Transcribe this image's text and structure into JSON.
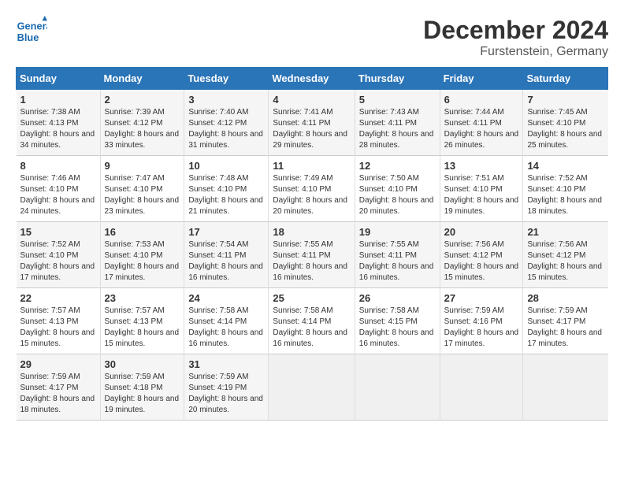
{
  "header": {
    "logo_line1": "General",
    "logo_line2": "Blue",
    "month": "December 2024",
    "location": "Furstenstein, Germany"
  },
  "weekdays": [
    "Sunday",
    "Monday",
    "Tuesday",
    "Wednesday",
    "Thursday",
    "Friday",
    "Saturday"
  ],
  "weeks": [
    [
      {
        "day": "1",
        "sunrise": "7:38 AM",
        "sunset": "4:13 PM",
        "daylight": "8 hours and 34 minutes."
      },
      {
        "day": "2",
        "sunrise": "7:39 AM",
        "sunset": "4:12 PM",
        "daylight": "8 hours and 33 minutes."
      },
      {
        "day": "3",
        "sunrise": "7:40 AM",
        "sunset": "4:12 PM",
        "daylight": "8 hours and 31 minutes."
      },
      {
        "day": "4",
        "sunrise": "7:41 AM",
        "sunset": "4:11 PM",
        "daylight": "8 hours and 29 minutes."
      },
      {
        "day": "5",
        "sunrise": "7:43 AM",
        "sunset": "4:11 PM",
        "daylight": "8 hours and 28 minutes."
      },
      {
        "day": "6",
        "sunrise": "7:44 AM",
        "sunset": "4:11 PM",
        "daylight": "8 hours and 26 minutes."
      },
      {
        "day": "7",
        "sunrise": "7:45 AM",
        "sunset": "4:10 PM",
        "daylight": "8 hours and 25 minutes."
      }
    ],
    [
      {
        "day": "8",
        "sunrise": "7:46 AM",
        "sunset": "4:10 PM",
        "daylight": "8 hours and 24 minutes."
      },
      {
        "day": "9",
        "sunrise": "7:47 AM",
        "sunset": "4:10 PM",
        "daylight": "8 hours and 23 minutes."
      },
      {
        "day": "10",
        "sunrise": "7:48 AM",
        "sunset": "4:10 PM",
        "daylight": "8 hours and 21 minutes."
      },
      {
        "day": "11",
        "sunrise": "7:49 AM",
        "sunset": "4:10 PM",
        "daylight": "8 hours and 20 minutes."
      },
      {
        "day": "12",
        "sunrise": "7:50 AM",
        "sunset": "4:10 PM",
        "daylight": "8 hours and 20 minutes."
      },
      {
        "day": "13",
        "sunrise": "7:51 AM",
        "sunset": "4:10 PM",
        "daylight": "8 hours and 19 minutes."
      },
      {
        "day": "14",
        "sunrise": "7:52 AM",
        "sunset": "4:10 PM",
        "daylight": "8 hours and 18 minutes."
      }
    ],
    [
      {
        "day": "15",
        "sunrise": "7:52 AM",
        "sunset": "4:10 PM",
        "daylight": "8 hours and 17 minutes."
      },
      {
        "day": "16",
        "sunrise": "7:53 AM",
        "sunset": "4:10 PM",
        "daylight": "8 hours and 17 minutes."
      },
      {
        "day": "17",
        "sunrise": "7:54 AM",
        "sunset": "4:11 PM",
        "daylight": "8 hours and 16 minutes."
      },
      {
        "day": "18",
        "sunrise": "7:55 AM",
        "sunset": "4:11 PM",
        "daylight": "8 hours and 16 minutes."
      },
      {
        "day": "19",
        "sunrise": "7:55 AM",
        "sunset": "4:11 PM",
        "daylight": "8 hours and 16 minutes."
      },
      {
        "day": "20",
        "sunrise": "7:56 AM",
        "sunset": "4:12 PM",
        "daylight": "8 hours and 15 minutes."
      },
      {
        "day": "21",
        "sunrise": "7:56 AM",
        "sunset": "4:12 PM",
        "daylight": "8 hours and 15 minutes."
      }
    ],
    [
      {
        "day": "22",
        "sunrise": "7:57 AM",
        "sunset": "4:13 PM",
        "daylight": "8 hours and 15 minutes."
      },
      {
        "day": "23",
        "sunrise": "7:57 AM",
        "sunset": "4:13 PM",
        "daylight": "8 hours and 15 minutes."
      },
      {
        "day": "24",
        "sunrise": "7:58 AM",
        "sunset": "4:14 PM",
        "daylight": "8 hours and 16 minutes."
      },
      {
        "day": "25",
        "sunrise": "7:58 AM",
        "sunset": "4:14 PM",
        "daylight": "8 hours and 16 minutes."
      },
      {
        "day": "26",
        "sunrise": "7:58 AM",
        "sunset": "4:15 PM",
        "daylight": "8 hours and 16 minutes."
      },
      {
        "day": "27",
        "sunrise": "7:59 AM",
        "sunset": "4:16 PM",
        "daylight": "8 hours and 17 minutes."
      },
      {
        "day": "28",
        "sunrise": "7:59 AM",
        "sunset": "4:17 PM",
        "daylight": "8 hours and 17 minutes."
      }
    ],
    [
      {
        "day": "29",
        "sunrise": "7:59 AM",
        "sunset": "4:17 PM",
        "daylight": "8 hours and 18 minutes."
      },
      {
        "day": "30",
        "sunrise": "7:59 AM",
        "sunset": "4:18 PM",
        "daylight": "8 hours and 19 minutes."
      },
      {
        "day": "31",
        "sunrise": "7:59 AM",
        "sunset": "4:19 PM",
        "daylight": "8 hours and 20 minutes."
      },
      null,
      null,
      null,
      null
    ]
  ]
}
